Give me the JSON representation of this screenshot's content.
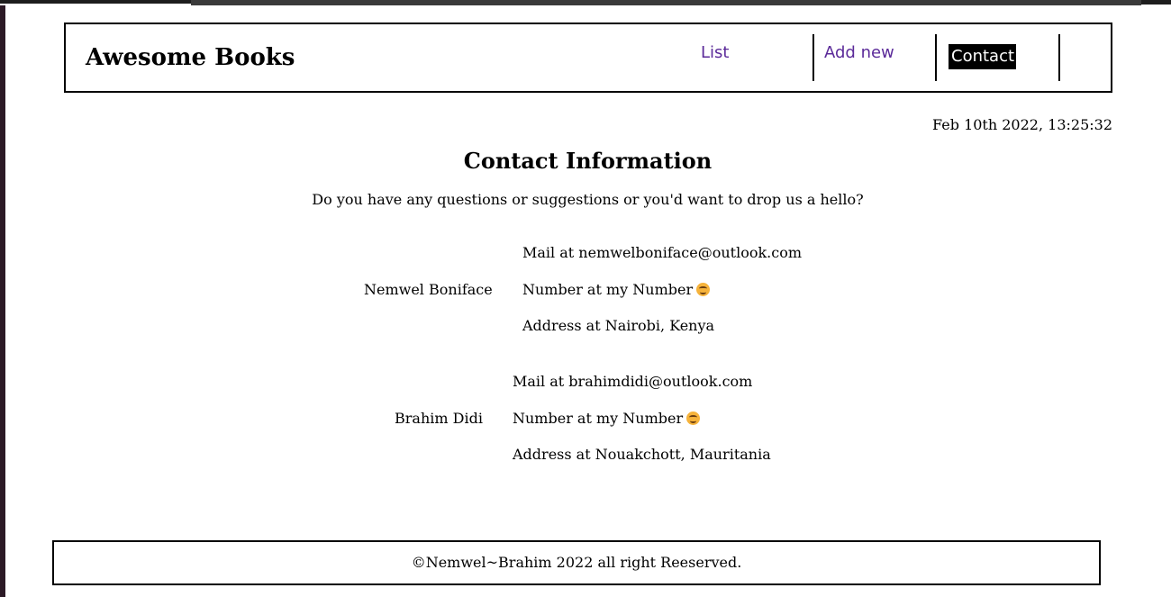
{
  "header": {
    "brand": "Awesome Books",
    "nav": {
      "list": "List",
      "add_new": "Add new",
      "contact": "Contact"
    }
  },
  "datetime": "Feb 10th 2022, 13:25:32",
  "contact": {
    "title": "Contact Information",
    "subtitle": "Do you have any questions or suggestions or you'd want to drop us a hello?",
    "people": [
      {
        "name": "Nemwel Boniface",
        "mail": "Mail at nemwelboniface@outlook.com",
        "number": "Number at my Number",
        "address": "Address at Nairobi, Kenya"
      },
      {
        "name": "Brahim Didi",
        "mail": "Mail at brahimdidi@outlook.com",
        "number": "Number at my Number",
        "address": "Address at Nouakchott, Mauritania"
      }
    ]
  },
  "footer": {
    "text": "©Nemwel~Brahim 2022 all right Reeserved."
  },
  "icons": {
    "number_emoji": "smiling-face-icon"
  },
  "colors": {
    "nav_link": "#5b2a99",
    "active_bg": "#000000",
    "active_text": "#ffffff"
  }
}
